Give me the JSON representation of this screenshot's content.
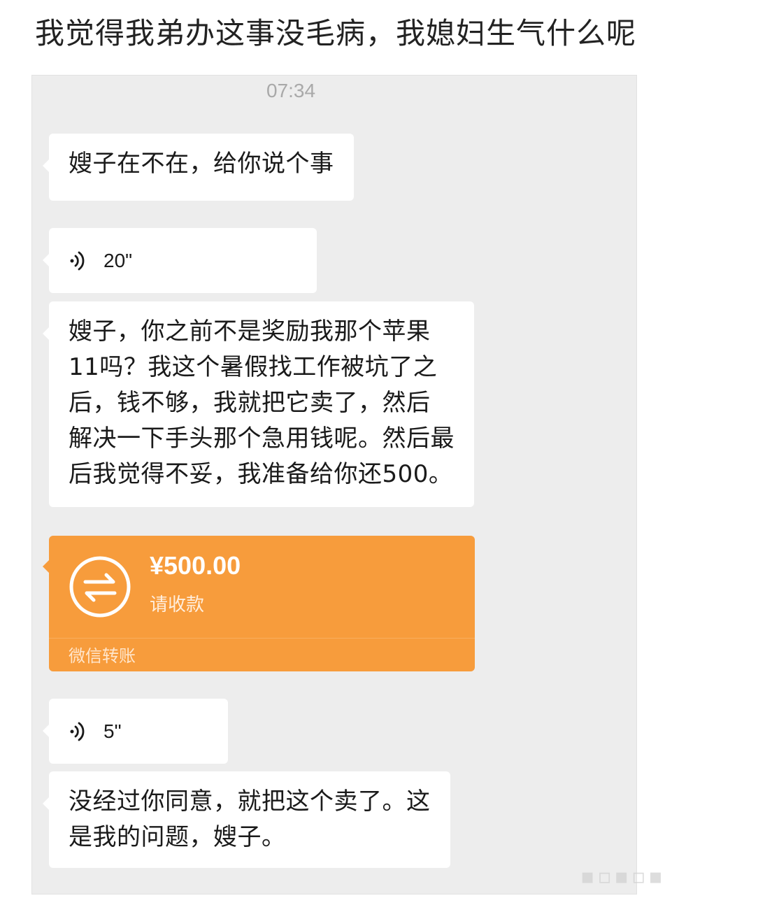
{
  "post": {
    "title": "我觉得我弟办这事没毛病，我媳妇生气什么呢"
  },
  "chat": {
    "timestamp": "07:34",
    "messages": [
      {
        "type": "text",
        "text": "嫂子在不在，给你说个事"
      },
      {
        "type": "voice",
        "duration": "20\""
      },
      {
        "type": "text",
        "text": "嫂子，你之前不是奖励我那个苹果\n11吗？我这个暑假找工作被坑了之\n后，钱不够，我就把它卖了，然后\n解决一下手头那个急用钱呢。然后最\n后我觉得不妥，我准备给你还500。"
      },
      {
        "type": "transfer",
        "amount": "¥500.00",
        "status": "请收款",
        "footer": "微信转账"
      },
      {
        "type": "voice",
        "duration": "5\""
      },
      {
        "type": "text",
        "text": "没经过你同意，就把这个卖了。这\n是我的问题，嫂子。"
      }
    ]
  },
  "colors": {
    "chat_background": "#ededed",
    "bubble": "#ffffff",
    "transfer_card": "#f79c3c"
  },
  "icons": {
    "voice": "voice-wave-icon",
    "transfer": "transfer-arrows-icon"
  }
}
